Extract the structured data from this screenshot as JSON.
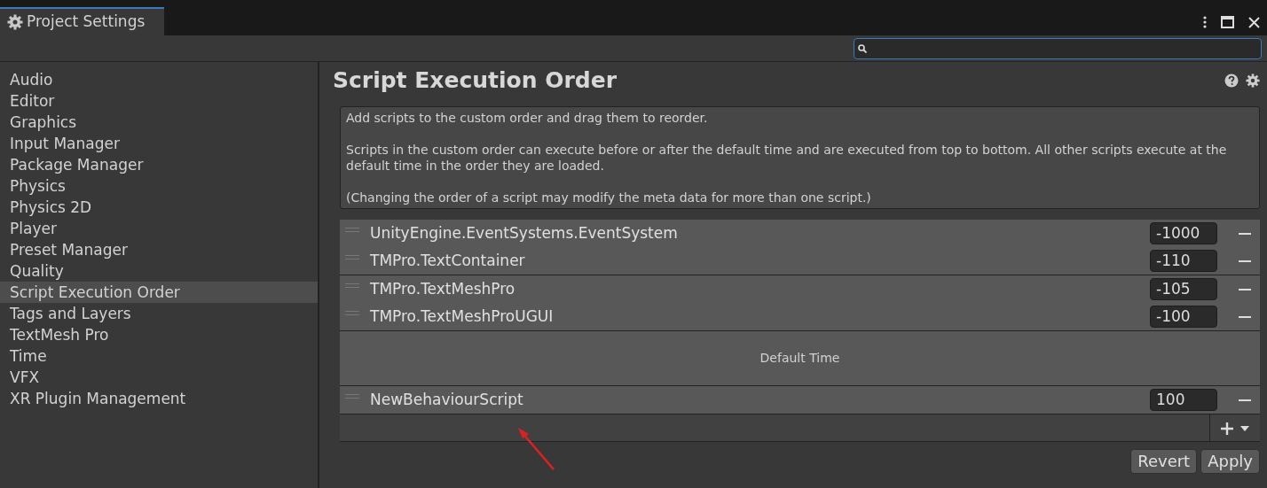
{
  "window": {
    "tab_title": "Project Settings"
  },
  "sidebar": {
    "items": [
      {
        "label": "Audio",
        "selected": false
      },
      {
        "label": "Editor",
        "selected": false
      },
      {
        "label": "Graphics",
        "selected": false
      },
      {
        "label": "Input Manager",
        "selected": false
      },
      {
        "label": "Package Manager",
        "selected": false
      },
      {
        "label": "Physics",
        "selected": false
      },
      {
        "label": "Physics 2D",
        "selected": false
      },
      {
        "label": "Player",
        "selected": false
      },
      {
        "label": "Preset Manager",
        "selected": false
      },
      {
        "label": "Quality",
        "selected": false
      },
      {
        "label": "Script Execution Order",
        "selected": true
      },
      {
        "label": "Tags and Layers",
        "selected": false
      },
      {
        "label": "TextMesh Pro",
        "selected": false
      },
      {
        "label": "Time",
        "selected": false
      },
      {
        "label": "VFX",
        "selected": false
      },
      {
        "label": "XR Plugin Management",
        "selected": false
      }
    ]
  },
  "page": {
    "title": "Script Execution Order",
    "help": [
      "Add scripts to the custom order and drag them to reorder.",
      "Scripts in the custom order can execute before or after the default time and are executed from top to bottom. All other scripts execute at the default time in the order they are loaded.",
      "(Changing the order of a script may modify the meta data for more than one script.)"
    ],
    "sections": [
      {
        "kind": "scripts",
        "rows": [
          {
            "name": "UnityEngine.EventSystems.EventSystem",
            "order": "-1000"
          },
          {
            "name": "TMPro.TextContainer",
            "order": "-110"
          }
        ]
      },
      {
        "kind": "scripts",
        "rows": [
          {
            "name": "TMPro.TextMeshPro",
            "order": "-105"
          },
          {
            "name": "TMPro.TextMeshProUGUI",
            "order": "-100"
          }
        ]
      },
      {
        "kind": "default_time",
        "label": "Default Time"
      },
      {
        "kind": "scripts",
        "rows": [
          {
            "name": "NewBehaviourScript",
            "order": "100"
          }
        ]
      }
    ],
    "buttons": [
      "Revert",
      "Apply"
    ]
  }
}
